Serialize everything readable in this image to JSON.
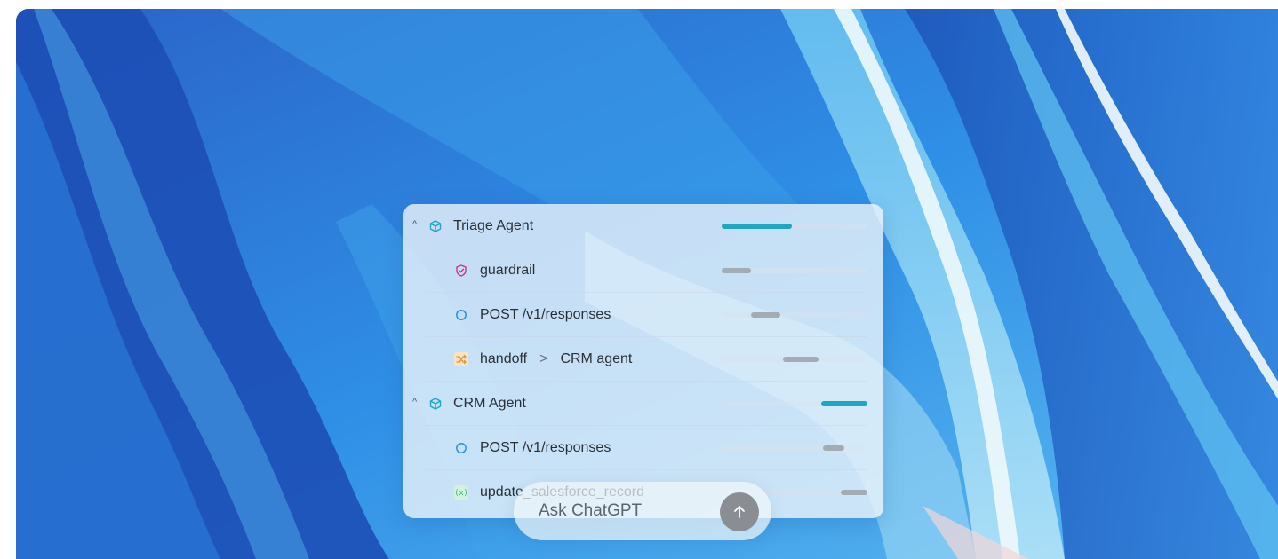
{
  "trace": {
    "rows": [
      {
        "label": "Triage Agent",
        "icon": "cube-icon",
        "expandable": true,
        "bar_start": 0.0,
        "bar_width": 0.48,
        "bar_color": "#1ea7c0"
      },
      {
        "label": "guardrail",
        "icon": "shield-check-icon",
        "expandable": false,
        "bar_start": 0.0,
        "bar_width": 0.2,
        "bar_color": "#a3abb3"
      },
      {
        "label": "POST /v1/responses",
        "icon": "circle-icon",
        "expandable": false,
        "bar_start": 0.2,
        "bar_width": 0.2,
        "bar_color": "#a3abb3"
      },
      {
        "label": "handoff",
        "label_target": "CRM agent",
        "icon": "shuffle-icon",
        "expandable": false,
        "bar_start": 0.42,
        "bar_width": 0.24,
        "bar_color": "#a3abb3"
      },
      {
        "label": "CRM Agent",
        "icon": "cube-icon",
        "expandable": true,
        "bar_start": 0.68,
        "bar_width": 0.32,
        "bar_color": "#1ea7c0"
      },
      {
        "label": "POST /v1/responses",
        "icon": "circle-icon",
        "expandable": false,
        "bar_start": 0.7,
        "bar_width": 0.14,
        "bar_color": "#a3abb3"
      },
      {
        "label": "update_salesforce_record",
        "icon": "function-icon",
        "expandable": false,
        "bar_start": 0.82,
        "bar_width": 0.18,
        "bar_color": "#a3abb3"
      }
    ],
    "chevron_glyph": ">",
    "caret_glyph": "^"
  },
  "composer": {
    "placeholder": "Ask ChatGPT",
    "send_icon": "arrow-up-icon"
  },
  "colors": {
    "teal": "#1ea7c0",
    "grey_bar": "#a3abb3",
    "agent_icon": "#1ea7c0",
    "guardrail_icon": "#c2368a",
    "request_icon": "#2b8fe0",
    "handoff_icon": "#e8962a",
    "function_icon": "#2bb673"
  }
}
